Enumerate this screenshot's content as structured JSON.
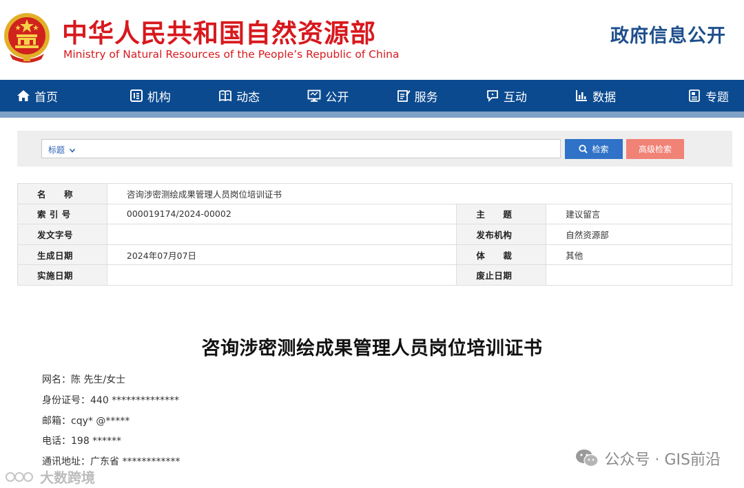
{
  "header": {
    "title_cn": "中华人民共和国自然资源部",
    "title_en": "Ministry of Natural Resources of the People’s Republic of China",
    "section": "政府信息公开"
  },
  "nav": {
    "items": [
      {
        "label": "首页",
        "icon": "home-icon"
      },
      {
        "label": "机构",
        "icon": "org-icon"
      },
      {
        "label": "动态",
        "icon": "book-icon"
      },
      {
        "label": "公开",
        "icon": "monitor-icon"
      },
      {
        "label": "服务",
        "icon": "edit-icon"
      },
      {
        "label": "互动",
        "icon": "chat-icon"
      },
      {
        "label": "数据",
        "icon": "bar-chart-icon"
      },
      {
        "label": "专题",
        "icon": "document-icon"
      }
    ]
  },
  "search": {
    "type_label": "标题",
    "value": "",
    "search_label": "检索",
    "advanced_label": "高级检索"
  },
  "info": {
    "name_label": "名　　称",
    "name_value": "咨询涉密测绘成果管理人员岗位培训证书",
    "index_label": "索 引 号",
    "index_value": "000019174/2024-00002",
    "topic_label": "主　　题",
    "topic_value": "建议留言",
    "docno_label": "发文字号",
    "docno_value": "",
    "publisher_label": "发布机构",
    "publisher_value": "自然资源部",
    "created_label": "生成日期",
    "created_value": "2024年07月07日",
    "genre_label": "体　　裁",
    "genre_value": "其他",
    "effective_label": "实施日期",
    "effective_value": "",
    "abolished_label": "废止日期",
    "abolished_value": ""
  },
  "article": {
    "title": "咨询涉密测绘成果管理人员岗位培训证书",
    "lines": [
      "网名：陈 先生/女士",
      "身份证号：440 **************",
      "邮箱：cqy* @*****",
      "电话：198 ******",
      "通讯地址：广东省 ************"
    ]
  },
  "watermarks": {
    "right": "公众号 · GIS前沿",
    "left": "大数跨境"
  },
  "colors": {
    "brand_red": "#d7191e",
    "nav_blue": "#0b4a8f",
    "search_blue": "#2f72c7",
    "advanced_red": "#f08276"
  }
}
